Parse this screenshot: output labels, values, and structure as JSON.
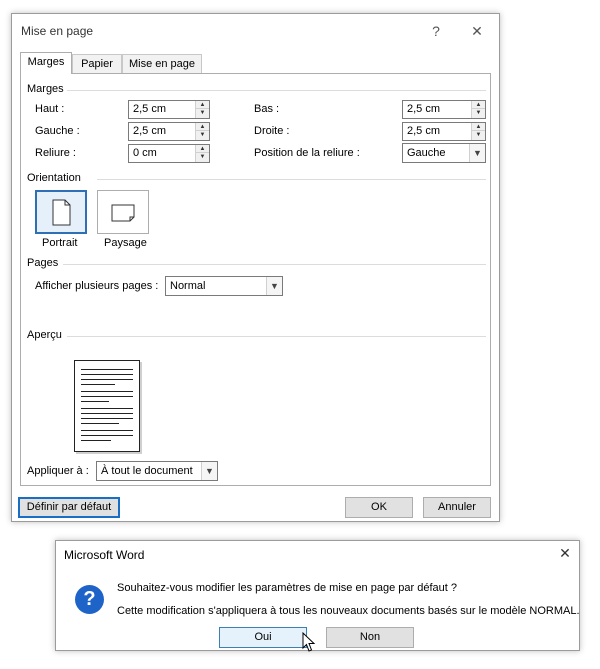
{
  "dialog": {
    "title": "Mise en page",
    "help_glyph": "?",
    "close_glyph": "✕",
    "tabs": [
      {
        "label": "Marges",
        "active": true
      },
      {
        "label": "Papier",
        "active": false
      },
      {
        "label": "Mise en page",
        "active": false
      }
    ],
    "margins": {
      "group_title": "Marges",
      "top": {
        "label": "Haut :",
        "value": "2,5 cm"
      },
      "bottom": {
        "label": "Bas :",
        "value": "2,5 cm"
      },
      "left": {
        "label": "Gauche :",
        "value": "2,5 cm"
      },
      "right": {
        "label": "Droite :",
        "value": "2,5 cm"
      },
      "gutter": {
        "label": "Reliure :",
        "value": "0 cm"
      },
      "gutter_position": {
        "label": "Position de la reliure :",
        "value": "Gauche"
      }
    },
    "orientation": {
      "group_title": "Orientation",
      "portrait_label": "Portrait",
      "landscape_label": "Paysage",
      "selected": "portrait"
    },
    "pages": {
      "group_title": "Pages",
      "multiple_label": "Afficher plusieurs pages :",
      "multiple_value": "Normal"
    },
    "preview": {
      "group_title": "Aperçu"
    },
    "apply": {
      "label": "Appliquer à :",
      "value": "À tout le document"
    },
    "buttons": {
      "default_label": "Définir par défaut",
      "ok_label": "OK",
      "cancel_label": "Annuler"
    },
    "accent_color": "#2e6fb5"
  },
  "message_box": {
    "title": "Microsoft Word",
    "close_glyph": "✕",
    "icon": "question-icon",
    "icon_glyph": "?",
    "question": "Souhaitez-vous modifier les paramètres de mise en page par défaut ?",
    "detail": "Cette modification s'appliquera à tous les nouveaux documents basés sur le modèle NORMAL.",
    "yes_label": "Oui",
    "no_label": "Non",
    "icon_color": "#1e64c8"
  }
}
